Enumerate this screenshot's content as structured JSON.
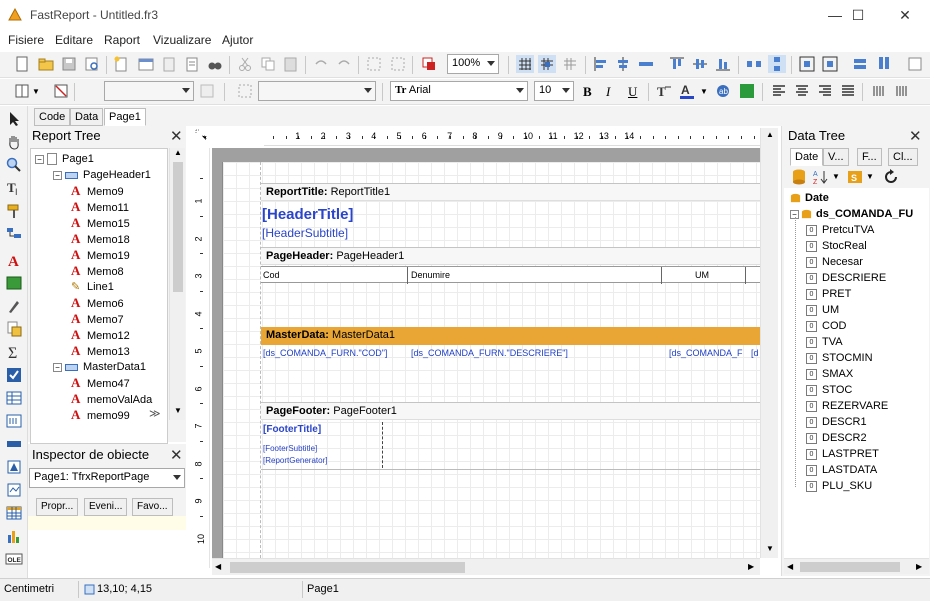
{
  "window": {
    "title": "FastReport - Untitled.fr3",
    "controls": [
      "—",
      "☐",
      "✕"
    ]
  },
  "menu": [
    "Fisiere",
    "Editare",
    "Raport",
    "Vizualizare",
    "Ajutor"
  ],
  "toolbar": {
    "zoom": "100%",
    "font_name": "Arial",
    "font_size": "10",
    "bold": "B",
    "italic": "I",
    "underline": "U"
  },
  "page_tabs": [
    "Code",
    "Data",
    "Page1"
  ],
  "report_tree": {
    "title": "Report Tree",
    "nodes": [
      {
        "label": "Page1",
        "level": 0,
        "kind": "page"
      },
      {
        "label": "PageHeader1",
        "level": 1,
        "kind": "band"
      },
      {
        "label": "Memo9",
        "level": 2,
        "kind": "memo"
      },
      {
        "label": "Memo11",
        "level": 2,
        "kind": "memo"
      },
      {
        "label": "Memo15",
        "level": 2,
        "kind": "memo"
      },
      {
        "label": "Memo18",
        "level": 2,
        "kind": "memo"
      },
      {
        "label": "Memo19",
        "level": 2,
        "kind": "memo"
      },
      {
        "label": "Memo8",
        "level": 2,
        "kind": "memo"
      },
      {
        "label": "Line1",
        "level": 2,
        "kind": "line"
      },
      {
        "label": "Memo6",
        "level": 2,
        "kind": "memo"
      },
      {
        "label": "Memo7",
        "level": 2,
        "kind": "memo"
      },
      {
        "label": "Memo12",
        "level": 2,
        "kind": "memo"
      },
      {
        "label": "Memo13",
        "level": 2,
        "kind": "memo"
      },
      {
        "label": "MasterData1",
        "level": 1,
        "kind": "band"
      },
      {
        "label": "Memo47",
        "level": 2,
        "kind": "memo"
      },
      {
        "label": "memoValAda",
        "level": 2,
        "kind": "memo"
      },
      {
        "label": "memo99",
        "level": 2,
        "kind": "memo"
      }
    ]
  },
  "inspector": {
    "title": "Inspector de obiecte",
    "selected": "Page1: TfrxReportPage",
    "tabs": [
      "Propr...",
      "Eveni...",
      "Favo..."
    ]
  },
  "ruler": {
    "h_ticks": [
      "1",
      "2",
      "3",
      "4",
      "5",
      "6",
      "7",
      "8",
      "9",
      "10",
      "11",
      "12",
      "13",
      "14"
    ],
    "v_ticks": [
      "1",
      "2",
      "3",
      "4",
      "5",
      "6",
      "7",
      "8",
      "9",
      "10"
    ]
  },
  "designer": {
    "report_title": {
      "type": "ReportTitle:",
      "name": "ReportTitle1",
      "header_title": "[HeaderTitle]",
      "header_subtitle": "[HeaderSubtitle]"
    },
    "page_header": {
      "type": "PageHeader:",
      "name": "PageHeader1",
      "columns": [
        "Cod",
        "Denumire",
        "UM"
      ]
    },
    "master_data": {
      "type": "MasterData:",
      "name": "MasterData1",
      "fields": [
        "[ds_COMANDA_FURN.\"COD\"]",
        "[ds_COMANDA_FURN.\"DESCRIERE\"]",
        "[ds_COMANDA_F",
        "[d"
      ]
    },
    "page_footer": {
      "type": "PageFooter:",
      "name": "PageFooter1",
      "footer_title": "[FooterTitle]",
      "footer_subtitle": "[FooterSubtitle]",
      "report_generator": "[ReportGenerator]"
    }
  },
  "data_tree": {
    "title": "Data Tree",
    "tabs": [
      "Date",
      "V...",
      "F...",
      "Cl..."
    ],
    "root": "Date",
    "dataset": "ds_COMANDA_FU",
    "fields": [
      "PretcuTVA",
      "StocReal",
      "Necesar",
      "DESCRIERE",
      "PRET",
      "UM",
      "COD",
      "TVA",
      "STOCMIN",
      "SMAX",
      "STOC",
      "REZERVARE",
      "DESCR1",
      "DESCR2",
      "LASTPRET",
      "LASTDATA",
      "PLU_SKU"
    ],
    "field_icon": "0"
  },
  "status": {
    "units": "Centimetri",
    "coords": "13,10; 4,15",
    "page": "Page1"
  },
  "colors": {
    "master_band": "#e9a635",
    "field_text": "#1f3fc6",
    "memo_icon": "#d01010",
    "dataset_icon": "#e8a018"
  }
}
